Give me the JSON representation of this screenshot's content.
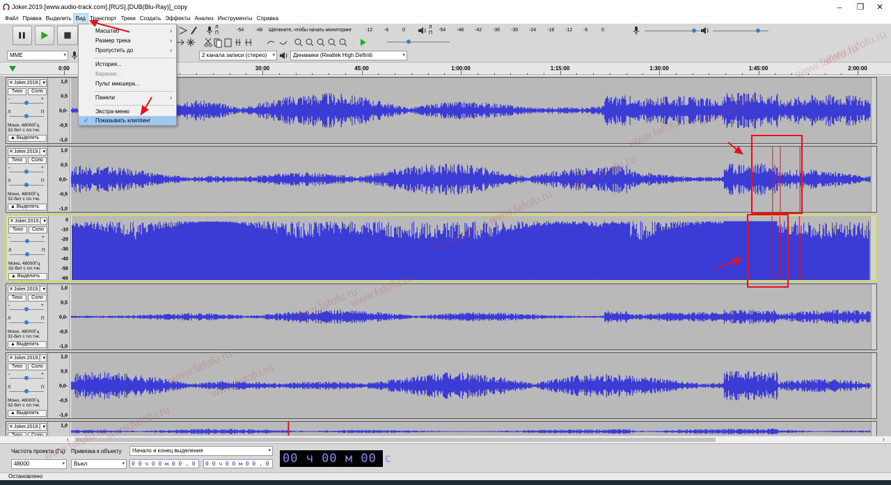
{
  "window": {
    "title": "Joker.2019.[www.audio-track.com].[RUS].[DUB(Blu-Ray)]_copy",
    "minimize": "–",
    "maximize": "❐",
    "close": "✕"
  },
  "menu": [
    "Файл",
    "Правка",
    "Выделить",
    "Вид",
    "Транспорт",
    "Треки",
    "Создать",
    "Эффекты",
    "Анализ",
    "Инструменты",
    "Справка"
  ],
  "active_menu": "Вид",
  "view_menu": {
    "items": [
      {
        "label": "Масштаб",
        "submenu": true
      },
      {
        "label": "Размер трека",
        "submenu": true
      },
      {
        "label": "Пропустить до",
        "submenu": true
      },
      {
        "label": "История..."
      },
      {
        "label": "Караоке...",
        "disabled": true
      },
      {
        "label": "Пульт микшера..."
      },
      {
        "label": "Панели",
        "submenu": true
      },
      {
        "label": "Экстра-меню"
      },
      {
        "label": "Показывать клиппинг",
        "checked": true,
        "highlighted": true
      }
    ],
    "submenu_arrow": "›",
    "check": "✓"
  },
  "meter": {
    "rec_ticks": [
      "-54",
      "-48",
      "-12",
      "-6",
      "0"
    ],
    "rec_hint": "Щёлкните, чтобы начать мониторинг",
    "play_ticks": [
      "-54",
      "-48",
      "-42",
      "-36",
      "-30",
      "-24",
      "-18",
      "-12",
      "-6",
      "0"
    ],
    "lr": [
      "Л",
      "П"
    ]
  },
  "device": {
    "host": "MME",
    "channels": "2 канала записи (стерео)",
    "output": "Динамики (Realtek High Definiti"
  },
  "ruler": {
    "labels": [
      "0:00",
      "30:00",
      "45:00",
      "1:00:00",
      "1:15:00",
      "1:30:00",
      "1:45:00",
      "2:00:00"
    ],
    "positions_data": [
      0,
      30,
      45,
      60,
      75,
      90,
      105,
      120
    ]
  },
  "track_defaults": {
    "name": "Joker.2019.[",
    "mute": "Тихо",
    "solo": "Соло",
    "minus": "–",
    "plus": "+",
    "left": "Л",
    "right": "П",
    "info1": "Моно, 48000Гц",
    "info2": "32-бит с пл.тчк.",
    "select": "Выделить"
  },
  "tracks": [
    {
      "scale": [
        "1,0",
        "0,5",
        "0,0-",
        "-0,5",
        "-1,0"
      ],
      "type": "linear",
      "amp": 0.55,
      "selected": false
    },
    {
      "scale": [
        "1,0",
        "0,5",
        "0,0-",
        "-0,5",
        "-1,0"
      ],
      "type": "linear",
      "amp": 0.5,
      "selected": false
    },
    {
      "scale": [
        "0",
        "-10",
        "-20",
        "-30",
        "-40",
        "-50",
        "-60"
      ],
      "type": "db",
      "amp": 1.0,
      "selected": true
    },
    {
      "scale": [
        "1,0",
        "0,5",
        "0,0-",
        "-0,5",
        "-1,0"
      ],
      "type": "linear",
      "amp": 0.22,
      "selected": false
    },
    {
      "scale": [
        "1,0",
        "0,5",
        "0,0-",
        "-0,5",
        "-1,0"
      ],
      "type": "linear",
      "amp": 0.45,
      "selected": false
    },
    {
      "scale": [
        "1,0"
      ],
      "type": "linear",
      "amp": 0.3,
      "selected": false
    }
  ],
  "bottom": {
    "rate_label": "Частота проекта (Гц)",
    "rate_value": "48000",
    "snap_label": "Привязка к объекту",
    "snap_value": "Выкл",
    "sel_label": "Начало и конец выделения",
    "sel_start": "0 0 ч 0 0 м 0 0 , 0 0 0 с",
    "sel_end": "0 0 ч 0 0 м 0 0 , 0 0 0 с",
    "big_time": "00 ч 00 м 00 с"
  },
  "status": "Остановлено",
  "watermark": "www.fafofu.ru",
  "colors": {
    "wave": "#3b3bd6",
    "clip": "#e8101a",
    "select_border": "#d8d85a"
  }
}
